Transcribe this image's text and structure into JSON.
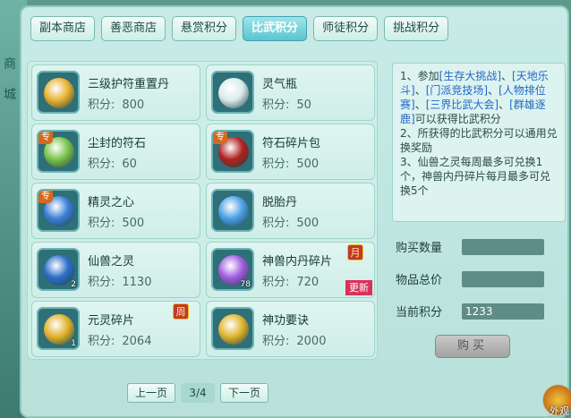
{
  "background": {
    "left_text": "商城"
  },
  "tabs": [
    {
      "label": "副本商店",
      "active": false
    },
    {
      "label": "善恶商店",
      "active": false
    },
    {
      "label": "悬赏积分",
      "active": false
    },
    {
      "label": "比武积分",
      "active": true
    },
    {
      "label": "师徒积分",
      "active": false
    },
    {
      "label": "挑战积分",
      "active": false
    }
  ],
  "score_label": "积分:",
  "items": [
    {
      "name": "三级护符重置丹",
      "score": "800",
      "icon": "golden-amulet-icon",
      "color": "#e8b230"
    },
    {
      "name": "灵气瓶",
      "score": "50",
      "icon": "spirit-vase-icon",
      "color": "#d9ecea"
    },
    {
      "name": "尘封的符石",
      "score": "60",
      "icon": "rune-stone-icon",
      "color": "#7ac34a",
      "tag": "专"
    },
    {
      "name": "符石碎片包",
      "score": "500",
      "icon": "rune-fragment-bag-icon",
      "color": "#b1221f",
      "tag": "专"
    },
    {
      "name": "精灵之心",
      "score": "500",
      "icon": "spirit-heart-icon",
      "color": "#3b7fd8",
      "tag": "专"
    },
    {
      "name": "脱胎丹",
      "score": "500",
      "icon": "rebirth-pill-icon",
      "color": "#4aa0e8"
    },
    {
      "name": "仙兽之灵",
      "score": "1130",
      "icon": "beast-spirit-icon",
      "color": "#2b6fc7",
      "count": "2"
    },
    {
      "name": "神兽内丹碎片",
      "score": "720",
      "icon": "beast-core-fragment-icon",
      "color": "#a25ce0",
      "count": "78",
      "badge": "月",
      "new": "更新"
    },
    {
      "name": "元灵碎片",
      "score": "2064",
      "icon": "yuanling-fragment-icon",
      "color": "#e2b22a",
      "count": "1",
      "badge": "周"
    },
    {
      "name": "神功要诀",
      "score": "2000",
      "icon": "manual-book-icon",
      "color": "#e0b52c"
    }
  ],
  "pager": {
    "prev": "上一页",
    "page": "3/4",
    "next": "下一页"
  },
  "description": {
    "line1_prefix": "1、参加",
    "acts": [
      "[生存大挑战]",
      "[天地乐斗]",
      "[门派竞技场]",
      "[人物排位赛]",
      "[三界比武大会]",
      "[群雄逐鹿]"
    ],
    "sep": "、",
    "line1_suffix": "可以获得比武积分",
    "line2": "2、所获得的比武积分可以通用兑换奖励",
    "line3": "3、仙兽之灵每周最多可兑换1个，神兽内丹碎片每月最多可兑换5个"
  },
  "purchase": {
    "qty_label": "购买数量",
    "qty_value": "",
    "total_label": "物品总价",
    "total_value": "",
    "current_label": "当前积分",
    "current_value": "1233",
    "buy_label": "购买"
  },
  "corner": {
    "text": "外观"
  }
}
